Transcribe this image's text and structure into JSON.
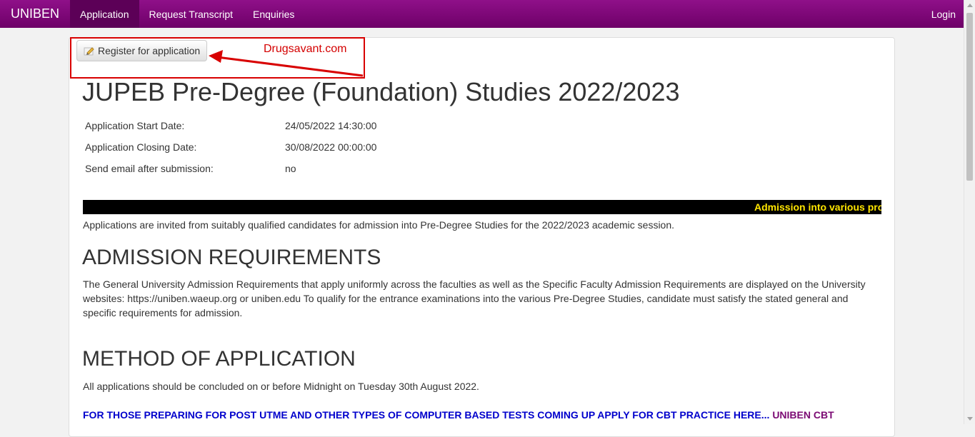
{
  "nav": {
    "brand": "UNIBEN",
    "items": [
      {
        "label": "Application"
      },
      {
        "label": "Request Transcript"
      },
      {
        "label": "Enquiries"
      }
    ],
    "login": "Login"
  },
  "register_button": "Register for application",
  "annotation": {
    "text": "Drugsavant.com",
    "color": "#d80000"
  },
  "title": "JUPEB Pre-Degree (Foundation) Studies 2022/2023",
  "info": [
    {
      "label": "Application Start Date:",
      "value": "24/05/2022 14:30:00"
    },
    {
      "label": "Application Closing Date:",
      "value": "30/08/2022 00:00:00"
    },
    {
      "label": "Send email after submission:",
      "value": "no"
    }
  ],
  "ticker": "Admission into various progra",
  "intro": "Applications are invited from suitably qualified candidates for admission into Pre-Degree Studies for the 2022/2023 academic session.",
  "admission": {
    "heading": "ADMISSION REQUIREMENTS",
    "text": "The General University Admission Requirements that apply uniformly across the faculties as well as the Specific Faculty Admission Requirements are displayed on the University websites: https://uniben.waeup.org or uniben.edu To qualify for the entrance examinations into the various Pre-Degree Studies, candidate must satisfy the stated general and specific requirements for admission."
  },
  "method": {
    "heading": "METHOD OF APPLICATION",
    "text": "All applications should be concluded on or before Midnight on Tuesday 30th August 2022."
  },
  "cbt": {
    "text": "FOR THOSE PREPARING FOR POST UTME AND OTHER TYPES OF COMPUTER BASED TESTS COMING UP APPLY FOR CBT PRACTICE HERE... ",
    "link": "UNIBEN CBT"
  },
  "colors": {
    "navbar": "#7e0878",
    "ticker_text": "#ffe600",
    "cbt_text": "#0000cc"
  }
}
